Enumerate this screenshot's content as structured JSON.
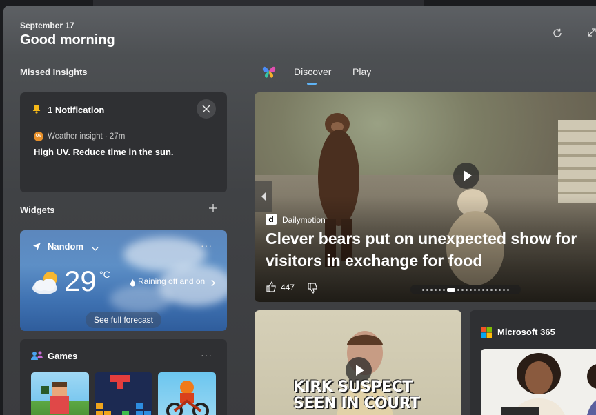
{
  "header": {
    "date": "September 17",
    "greeting": "Good morning"
  },
  "missed_insights": {
    "section_title": "Missed Insights",
    "notification_title": "1 Notification",
    "badge": "UV",
    "meta": "Weather insight · 27m",
    "body": "High UV. Reduce time in the sun."
  },
  "widgets": {
    "section_title": "Widgets",
    "weather": {
      "location": "Nandom",
      "temperature": "29",
      "unit": "°C",
      "condition": "Raining off and on",
      "forecast_button": "See full forecast"
    },
    "games": {
      "title": "Games"
    }
  },
  "feed": {
    "tabs": [
      {
        "label": "Discover",
        "active": true
      },
      {
        "label": "Play",
        "active": false
      }
    ],
    "hero": {
      "source_logo": "d",
      "source": "Dailymotion",
      "headline": "Clever bears put on unexpected show for visitors in exchange for food",
      "likes": "447",
      "pager_total": 20,
      "pager_active": 6
    },
    "second": {
      "overlay_line1": "KIRK SUSPECT",
      "overlay_line2": "SEEN IN COURT"
    },
    "m365": {
      "title": "Microsoft 365"
    }
  },
  "colors": {
    "accent": "#5fb3f5",
    "panel": "#404245",
    "card": "#2f3033",
    "weather_card": "#4f7fbb"
  }
}
